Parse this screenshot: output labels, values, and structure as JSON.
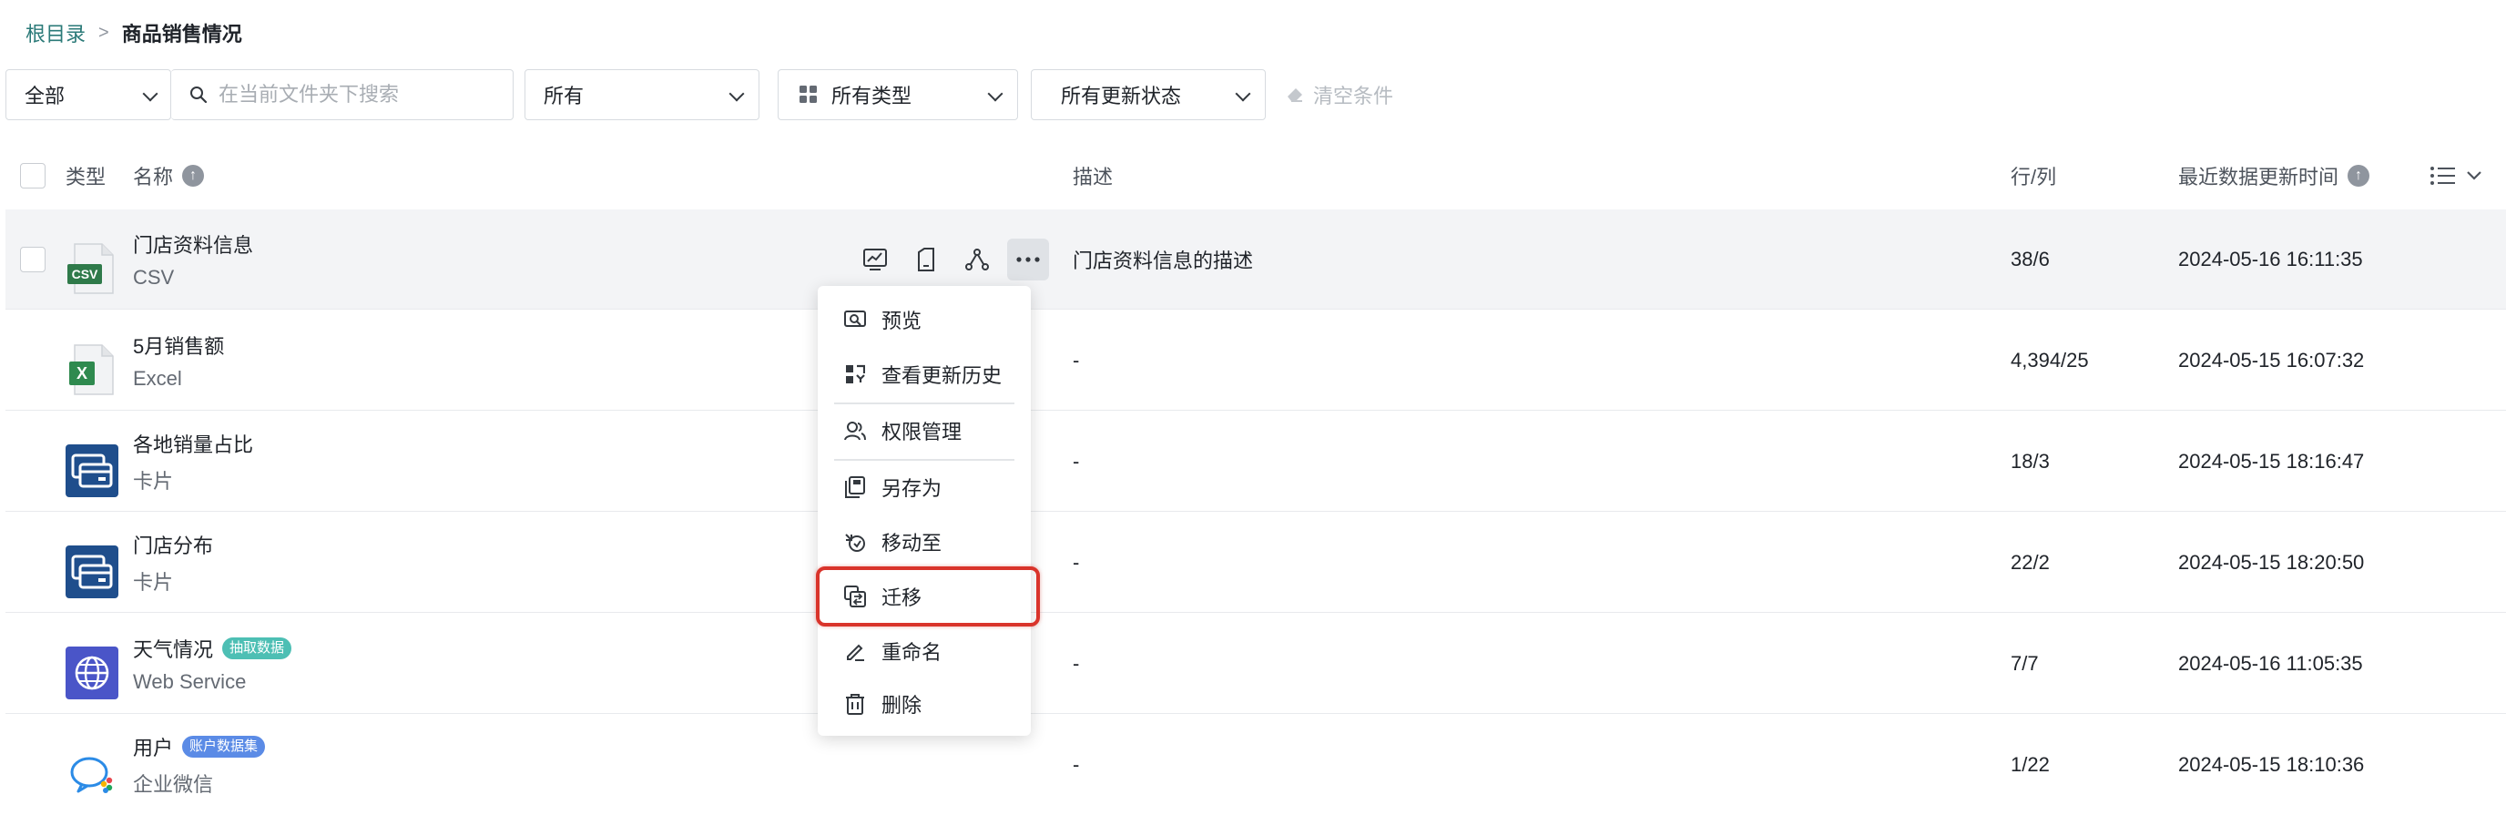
{
  "breadcrumb": {
    "root": "根目录",
    "separator": ">",
    "current": "商品销售情况"
  },
  "filters": {
    "scope": "全部",
    "search_placeholder": "在当前文件夹下搜索",
    "owner": "所有",
    "type": "所有类型",
    "update_status": "所有更新状态",
    "clear": "清空条件"
  },
  "table": {
    "headers": {
      "type": "类型",
      "name": "名称",
      "description": "描述",
      "rows_cols": "行/列",
      "last_update": "最近数据更新时间"
    },
    "rows": [
      {
        "name": "门店资料信息",
        "type": "CSV",
        "description": "门店资料信息的描述",
        "rows_cols": "38/6",
        "updated": "2024-05-16 16:11:35",
        "icon": "csv-file-icon",
        "tag": ""
      },
      {
        "name": "5月销售额",
        "type": "Excel",
        "description": "-",
        "rows_cols": "4,394/25",
        "updated": "2024-05-15 16:07:32",
        "icon": "excel-file-icon",
        "tag": ""
      },
      {
        "name": "各地销量占比",
        "type": "卡片",
        "description": "-",
        "rows_cols": "18/3",
        "updated": "2024-05-15 18:16:47",
        "icon": "card-icon",
        "tag": ""
      },
      {
        "name": "门店分布",
        "type": "卡片",
        "description": "-",
        "rows_cols": "22/2",
        "updated": "2024-05-15 18:20:50",
        "icon": "card-icon",
        "tag": ""
      },
      {
        "name": "天气情况",
        "type": "Web Service",
        "description": "-",
        "rows_cols": "7/7",
        "updated": "2024-05-16 11:05:35",
        "icon": "globe-icon",
        "tag": "抽取数据"
      },
      {
        "name": "用户",
        "type": "企业微信",
        "description": "-",
        "rows_cols": "1/22",
        "updated": "2024-05-15 18:10:36",
        "icon": "wecom-icon",
        "tag": "账户数据集"
      }
    ]
  },
  "context_menu": {
    "items": [
      "预览",
      "查看更新历史",
      "权限管理",
      "另存为",
      "移动至",
      "迁移",
      "重命名",
      "删除"
    ],
    "highlighted": "迁移"
  },
  "colors": {
    "accent": "#2b7a78",
    "highlight_border": "#d9342b",
    "tag_extract": "#4dbfb4",
    "tag_account": "#5b8be6",
    "card_icon": "#1f4e8c",
    "globe_icon": "#4a55c8",
    "excel": "#2f8a4f"
  }
}
